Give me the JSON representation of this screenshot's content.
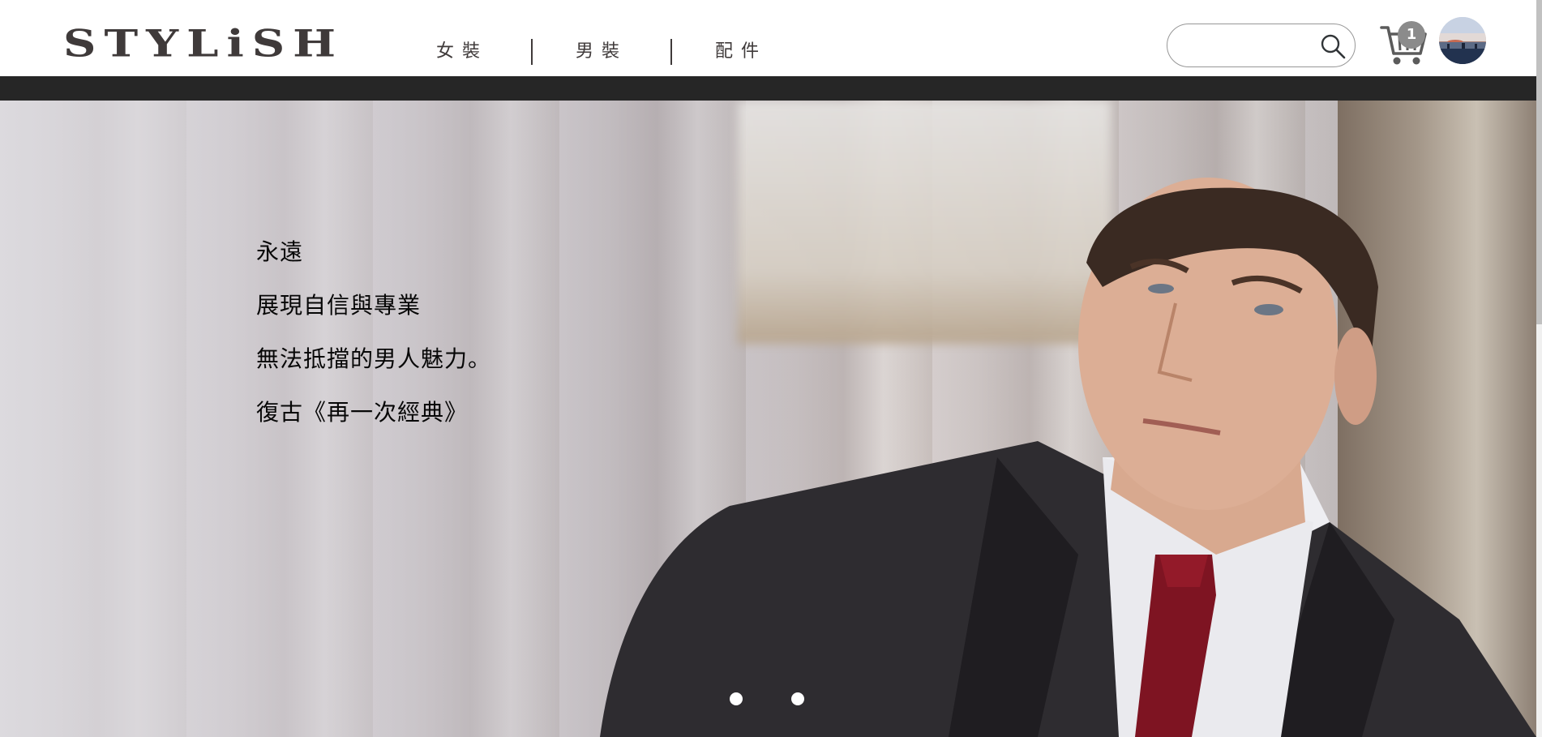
{
  "header": {
    "logo_text": "STYLiSH",
    "nav": [
      {
        "label": "女裝"
      },
      {
        "label": "男裝"
      },
      {
        "label": "配件"
      }
    ],
    "search": {
      "value": "",
      "placeholder": ""
    },
    "cart": {
      "count": "1"
    },
    "icons": {
      "search": "search-icon",
      "cart": "cart-icon",
      "avatar": "user-avatar"
    }
  },
  "hero": {
    "lines": [
      "永遠",
      "展現自信與專業",
      "無法抵擋的男人魅力。",
      "復古《再一次經典》"
    ],
    "carousel": {
      "total": 3,
      "active": 2
    }
  },
  "colors": {
    "brand_text": "#3f3a3a",
    "header_bar": "#262626",
    "badge": "#8b8b8b"
  }
}
